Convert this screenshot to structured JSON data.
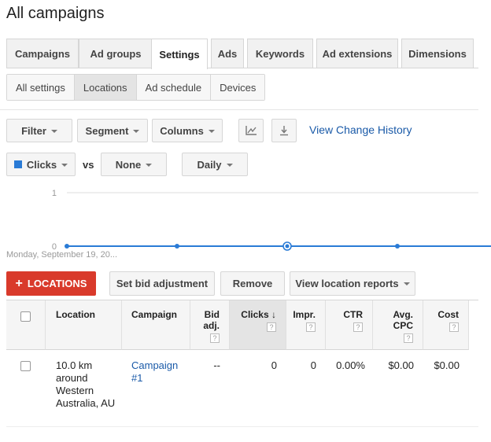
{
  "page_title": "All campaigns",
  "tabs": [
    "Campaigns",
    "Ad groups",
    "Settings",
    "Ads",
    "Keywords",
    "Ad extensions",
    "Dimensions"
  ],
  "active_tab": "Settings",
  "subtabs": [
    "All settings",
    "Locations",
    "Ad schedule",
    "Devices"
  ],
  "active_subtab": "Locations",
  "toolbar": {
    "filter": "Filter",
    "segment": "Segment",
    "columns": "Columns",
    "chart_icon": "line-chart-icon",
    "download_icon": "download-icon",
    "change_history": "View Change History"
  },
  "chart_controls": {
    "metric1": "Clicks",
    "metric1_color": "#2a7bd6",
    "vs": "vs",
    "metric2": "None",
    "period": "Daily"
  },
  "chart_data": {
    "type": "line",
    "series": [
      {
        "name": "Clicks",
        "values": [
          0,
          0,
          0,
          0,
          0
        ]
      }
    ],
    "y_ticks": [
      "1",
      "0"
    ],
    "ylim": [
      0,
      1
    ],
    "x_label_start": "Monday, September 19, 20..."
  },
  "actions": {
    "add_locations": "LOCATIONS",
    "set_bid": "Set bid adjustment",
    "remove": "Remove",
    "view_reports": "View location reports"
  },
  "table": {
    "headers": {
      "location": "Location",
      "campaign": "Campaign",
      "bid_adj": "Bid adj.",
      "clicks": "Clicks",
      "impr": "Impr.",
      "ctr": "CTR",
      "avg_cpc": "Avg. CPC",
      "cost": "Cost",
      "help": "?"
    },
    "rows": [
      {
        "location": "10.0 km around Western Australia, AU",
        "campaign": "Campaign #1",
        "bid_adj": "--",
        "clicks": "0",
        "impr": "0",
        "ctr": "0.00%",
        "avg_cpc": "$0.00",
        "cost": "$0.00"
      }
    ]
  }
}
